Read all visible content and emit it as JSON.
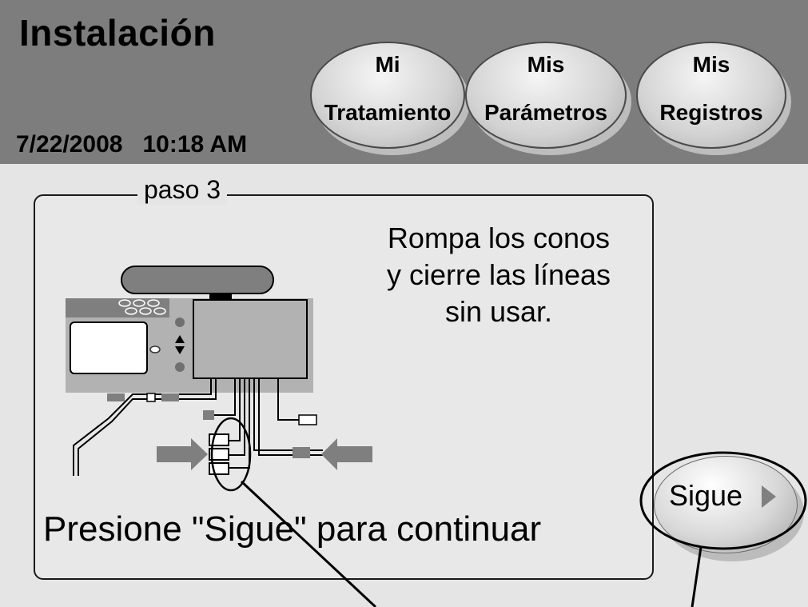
{
  "header": {
    "title": "Instalación",
    "date": "7/22/2008",
    "time": "10:18 AM",
    "nav": [
      {
        "line1": "Mi",
        "line2": "Tratamiento"
      },
      {
        "line1": "Mis",
        "line2": "Parámetros"
      },
      {
        "line1": "Mis",
        "line2": "Registros"
      }
    ]
  },
  "step": {
    "label": "paso 3",
    "instruction_lines": [
      "Rompa los conos",
      "y cierre las líneas",
      "sin usar."
    ],
    "continue_text": "Presione \"Sigue\" para continuar"
  },
  "next_button": {
    "label": "Sigue",
    "icon": "play-triangle-icon"
  },
  "colors": {
    "header": "#7d7d7d",
    "background": "#e5e5e5",
    "device_gray": "#a6a6a6",
    "arrow_gray": "#7f7f7f"
  }
}
